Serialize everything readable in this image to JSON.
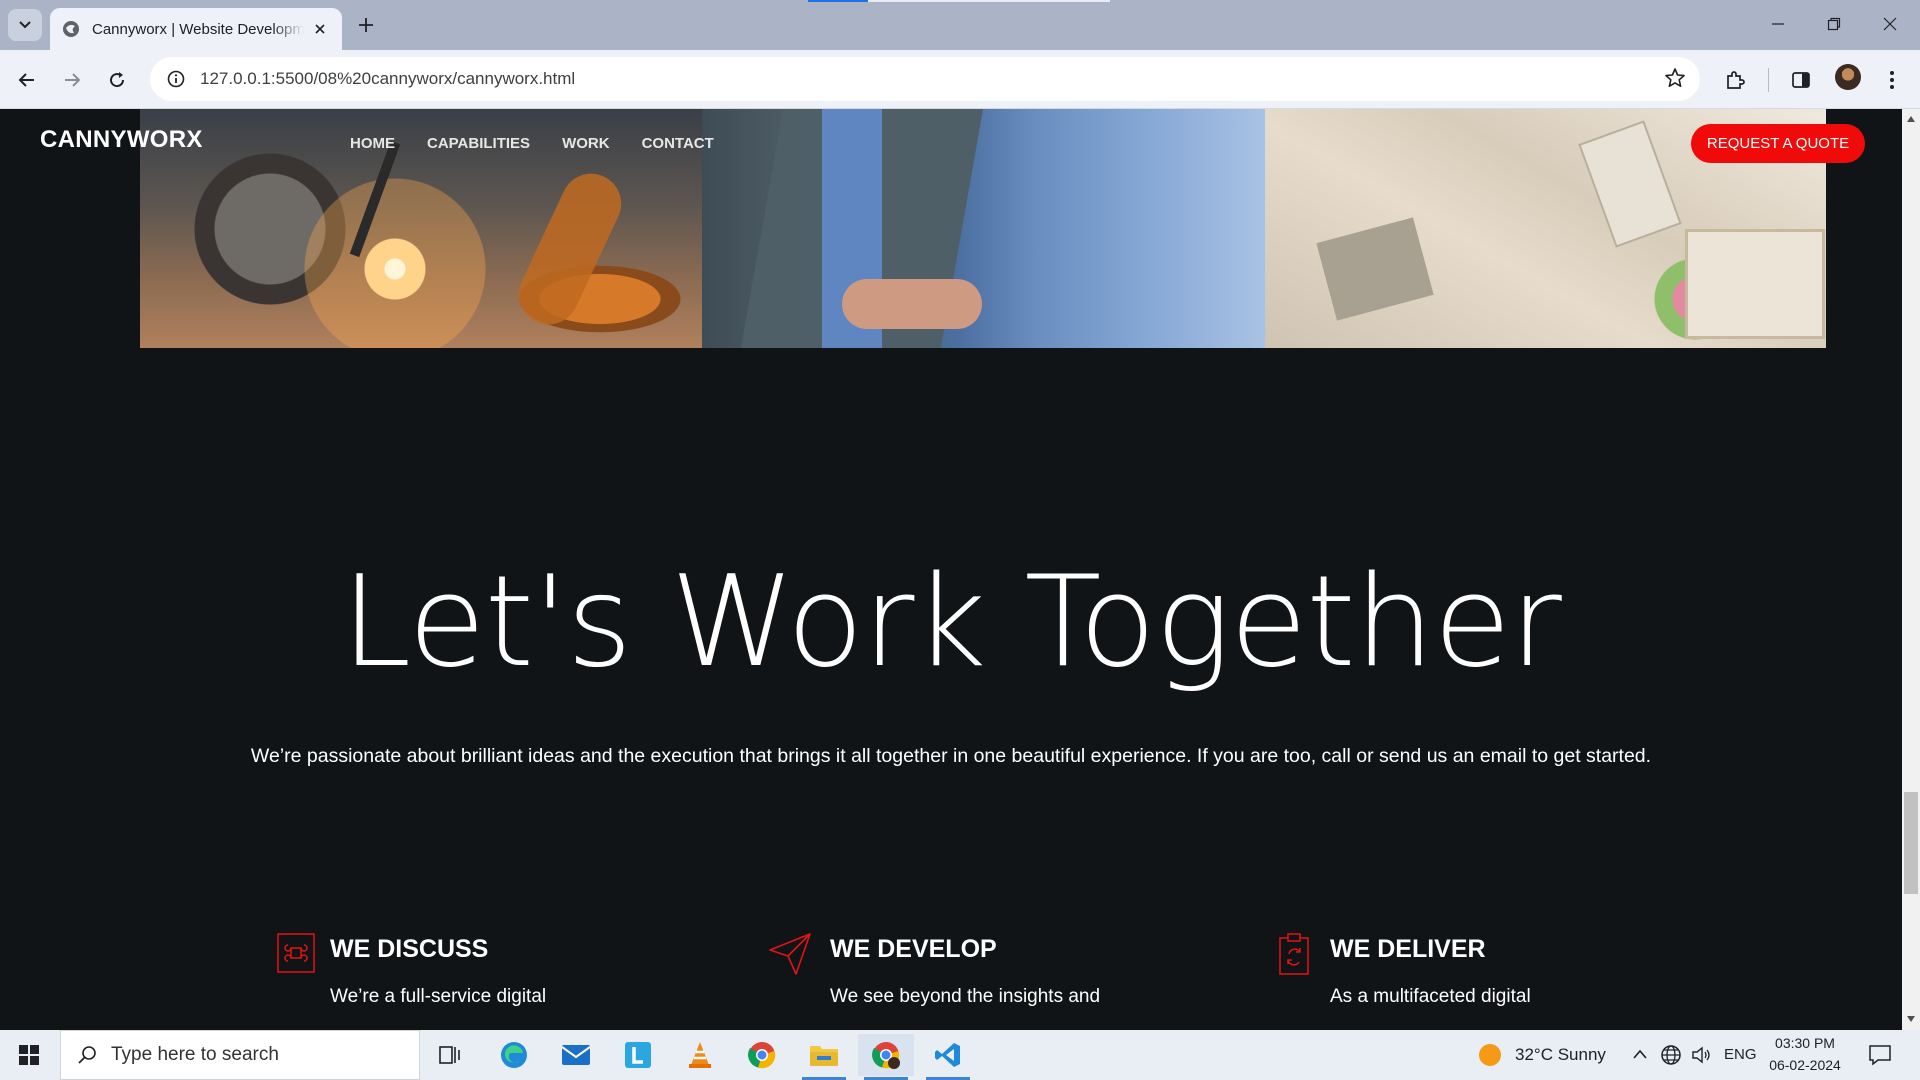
{
  "browser": {
    "tab_title": "Cannyworx | Website Development",
    "url": "127.0.0.1:5500/08%20cannyworx/cannyworx.html"
  },
  "site": {
    "brand": "CANNYWORX",
    "nav": [
      "HOME",
      "CAPABILITIES",
      "WORK",
      "CONTACT"
    ],
    "cta": "REQUEST A QUOTE"
  },
  "hero": {
    "title": "Let's Work Together",
    "subtitle": "We’re passionate about brilliant ideas and the execution that brings it all together in one beautiful experience. If you are too, call or send us an email to get started."
  },
  "features": [
    {
      "title": "WE DISCUSS",
      "text": "We’re a full-service digital",
      "icon": "command-icon"
    },
    {
      "title": "WE DEVELOP",
      "text": "We see beyond the insights and",
      "icon": "paper-plane-icon"
    },
    {
      "title": "WE DELIVER",
      "text": "As a multifaceted digital",
      "icon": "clipboard-sync-icon"
    }
  ],
  "taskbar": {
    "search_placeholder": "Type here to search",
    "weather": "32°C  Sunny",
    "language": "ENG",
    "time": "03:30 PM",
    "date": "06-02-2024"
  },
  "colors": {
    "accent": "#f00a0a",
    "page_bg": "#111417"
  }
}
